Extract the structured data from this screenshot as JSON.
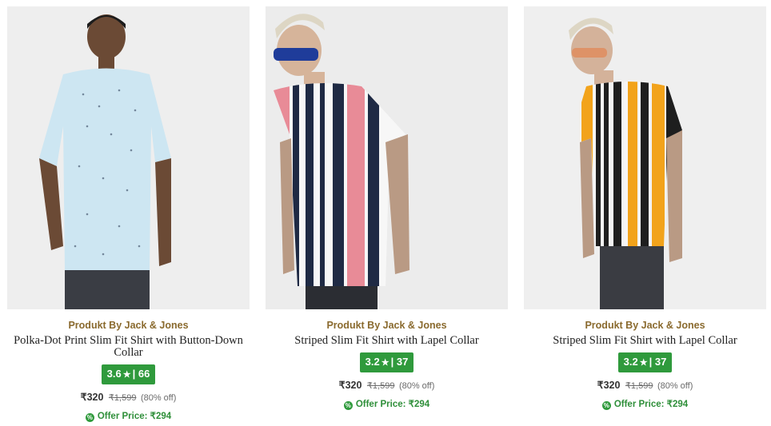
{
  "products": [
    {
      "brand": "Produkt By Jack & Jones",
      "title": "Polka-Dot Print Slim Fit Shirt with Button-Down Collar",
      "rating": "3.6",
      "reviews": "66",
      "price": "₹320",
      "mrp": "₹1,599",
      "discount": "(80% off)",
      "offer": "Offer Price: ₹294"
    },
    {
      "brand": "Produkt By Jack & Jones",
      "title": "Striped Slim Fit Shirt with Lapel Collar",
      "rating": "3.2",
      "reviews": "37",
      "price": "₹320",
      "mrp": "₹1,599",
      "discount": "(80% off)",
      "offer": "Offer Price: ₹294"
    },
    {
      "brand": "Produkt By Jack & Jones",
      "title": "Striped Slim Fit Shirt with Lapel Collar",
      "rating": "3.2",
      "reviews": "37",
      "price": "₹320",
      "mrp": "₹1,599",
      "discount": "(80% off)",
      "offer": "Offer Price: ₹294"
    }
  ],
  "icons": {
    "star": "star-icon",
    "offer": "offer-tag-icon"
  },
  "colors": {
    "brand": "#8a6a2e",
    "rating_badge": "#2f9a3c",
    "offer": "#2f8f3a"
  }
}
